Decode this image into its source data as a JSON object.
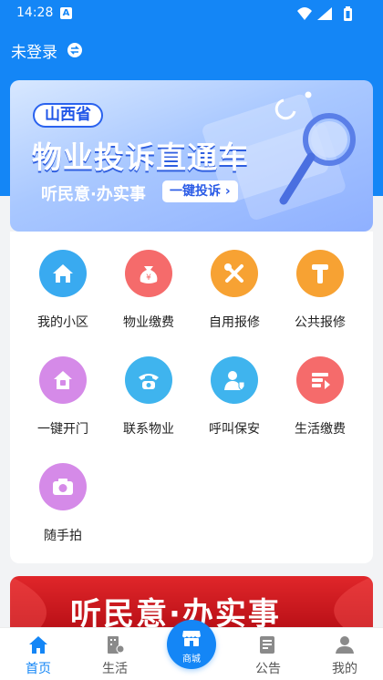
{
  "status_bar": {
    "time": "14:28",
    "notification_letter": "A"
  },
  "header": {
    "login_label": "未登录"
  },
  "banner": {
    "tag": "山西省",
    "title": "物业投诉直通车",
    "subtitle": "听民意·办实事",
    "cta": "一键投诉 ›"
  },
  "menu": {
    "items": [
      {
        "label": "我的小区",
        "icon": "home-icon",
        "color": "#39aaf0"
      },
      {
        "label": "物业缴费",
        "icon": "money-bag-icon",
        "color": "#f56b6b"
      },
      {
        "label": "自用报修",
        "icon": "tools-icon",
        "color": "#f7a233"
      },
      {
        "label": "公共报修",
        "icon": "hammer-icon",
        "color": "#f7a233"
      },
      {
        "label": "一键开门",
        "icon": "door-unlock-icon",
        "color": "#d58ae8"
      },
      {
        "label": "联系物业",
        "icon": "telephone-icon",
        "color": "#3fb4ee"
      },
      {
        "label": "呼叫保安",
        "icon": "security-guard-icon",
        "color": "#3fb4ee"
      },
      {
        "label": "生活缴费",
        "icon": "bill-pay-icon",
        "color": "#f56b6b"
      },
      {
        "label": "随手拍",
        "icon": "camera-icon",
        "color": "#d58ae8"
      }
    ]
  },
  "bottom_banner": {
    "text": "听民意·办实事"
  },
  "tabbar": {
    "home": "首页",
    "life": "生活",
    "mall": "商城",
    "notice": "公告",
    "mine": "我的",
    "active_color": "#1486f6"
  }
}
